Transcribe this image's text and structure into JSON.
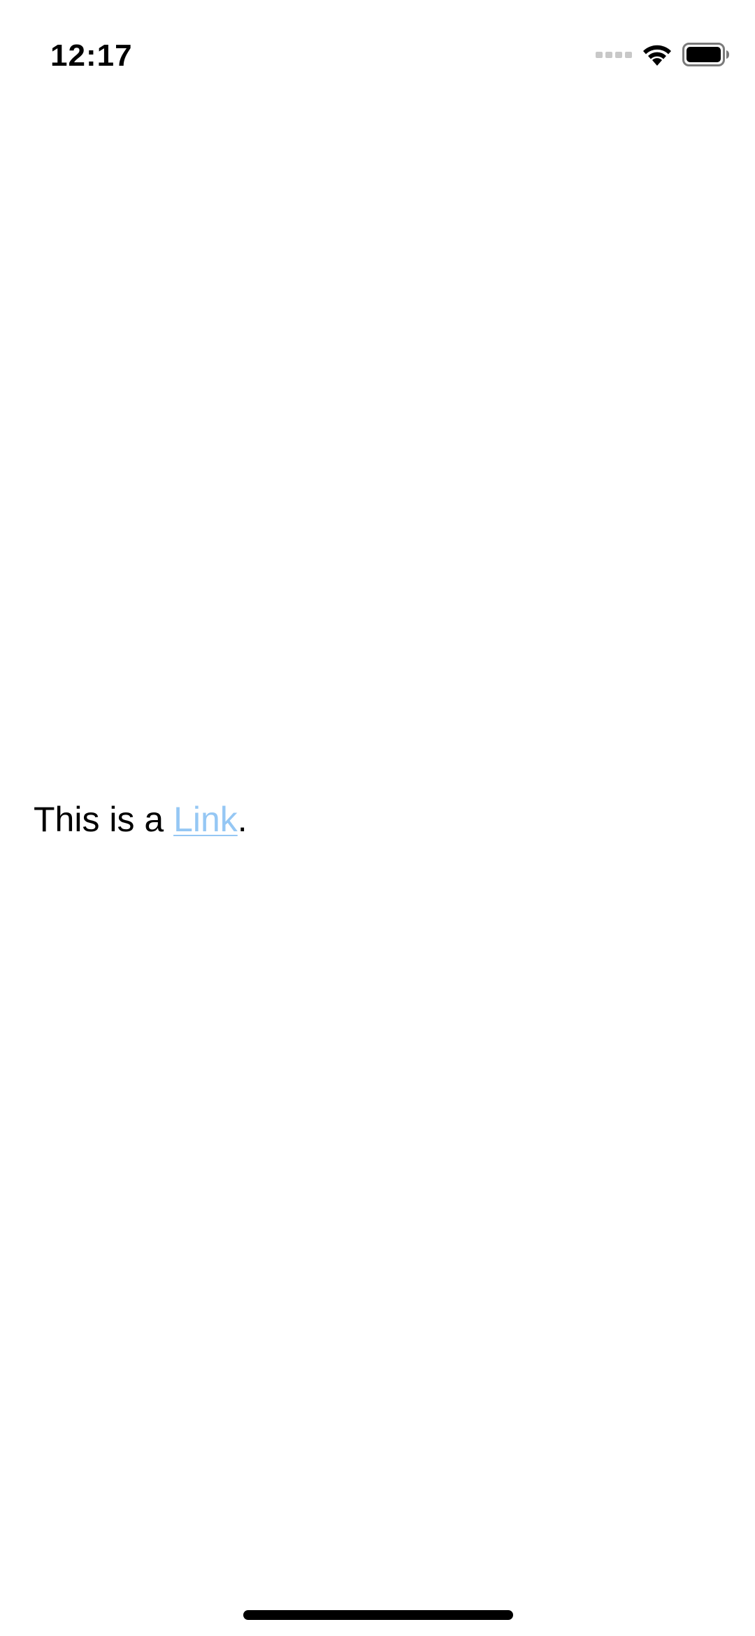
{
  "status_bar": {
    "time": "12:17",
    "icons": [
      "cellular-signal-icon",
      "wifi-icon",
      "battery-icon"
    ]
  },
  "content": {
    "prefix": "This is a ",
    "link_text": "Link",
    "suffix": "."
  },
  "colors": {
    "link": "#95c7f4",
    "text": "#000000",
    "background": "#ffffff"
  }
}
